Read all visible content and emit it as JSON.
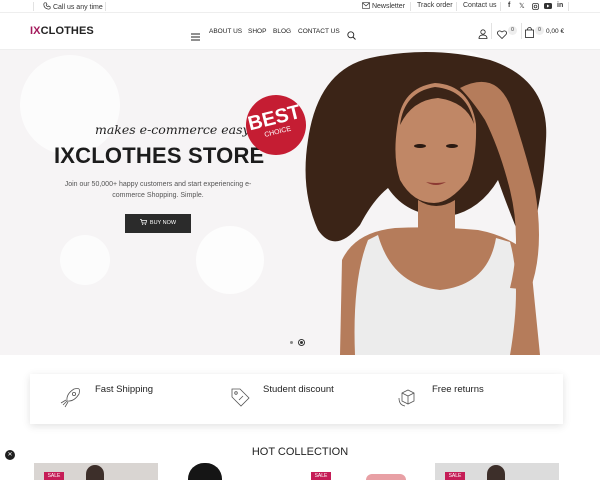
{
  "topbar": {
    "call": "Call us any time",
    "newsletter": "Newsletter",
    "track": "Track order",
    "contact": "Contact us"
  },
  "header": {
    "logo_ix": "IX",
    "logo_rest": "CLOTHES",
    "nav": [
      "ABOUT US",
      "SHOP",
      "BLOG",
      "CONTACT US"
    ],
    "wishlist_count": "0",
    "cart_count": "0",
    "cart_total": "0,00 €"
  },
  "hero": {
    "tagline": "makes e-commerce easy",
    "title": "IXCLOTHES STORE",
    "subtitle": "Join our 50,000+ happy customers and start experiencing e-commerce Shopping. Simple.",
    "button": "BUY NOW",
    "badge_big": "BEST",
    "badge_small": "CHOICE"
  },
  "features": [
    "Fast Shipping",
    "Student discount",
    "Free returns"
  ],
  "section_title": "HOT COLLECTION",
  "sale_label": "SALE",
  "colors": {
    "accent": "#a3195b",
    "badge": "#c51d33",
    "dark_button": "#2b2b2b"
  }
}
